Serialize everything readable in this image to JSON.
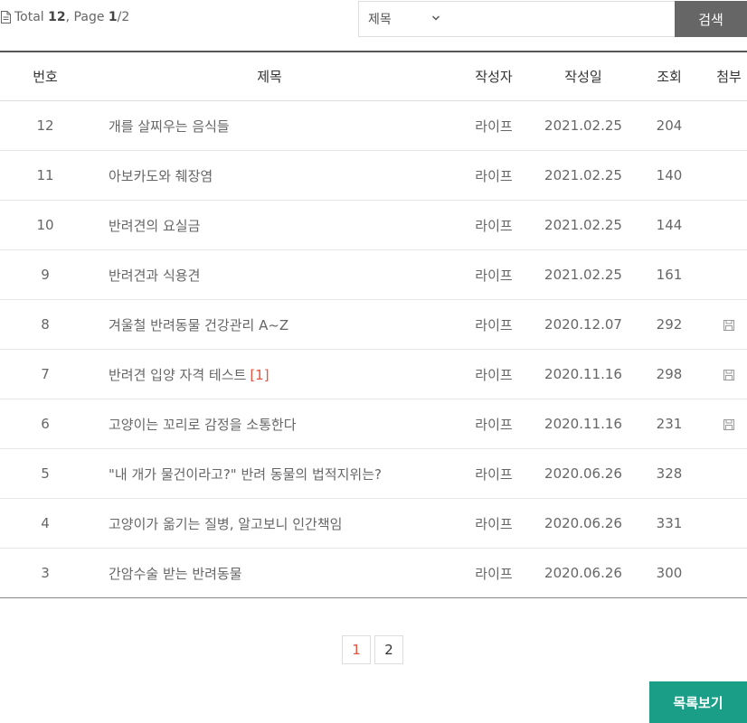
{
  "summary": {
    "total_label": "Total",
    "total": "12",
    "page_label": "Page",
    "page_current": "1",
    "page_total": "2"
  },
  "search": {
    "field_selected": "제목",
    "query": "",
    "button_label": "검색"
  },
  "table": {
    "headers": {
      "num": "번호",
      "title": "제목",
      "author": "작성자",
      "date": "작성일",
      "views": "조회",
      "attach": "첨부"
    },
    "rows": [
      {
        "num": "12",
        "title": "개를 살찌우는 음식들",
        "comments": "",
        "author": "라이프",
        "date": "2021.02.25",
        "views": "204",
        "attachment": false
      },
      {
        "num": "11",
        "title": "아보카도와 췌장염",
        "comments": "",
        "author": "라이프",
        "date": "2021.02.25",
        "views": "140",
        "attachment": false
      },
      {
        "num": "10",
        "title": "반려견의 요실금",
        "comments": "",
        "author": "라이프",
        "date": "2021.02.25",
        "views": "144",
        "attachment": false
      },
      {
        "num": "9",
        "title": "반려견과 식용견",
        "comments": "",
        "author": "라이프",
        "date": "2021.02.25",
        "views": "161",
        "attachment": false
      },
      {
        "num": "8",
        "title": "겨울철 반려동물 건강관리 A~Z",
        "comments": "",
        "author": "라이프",
        "date": "2020.12.07",
        "views": "292",
        "attachment": true
      },
      {
        "num": "7",
        "title": "반려견 입양 자격 테스트",
        "comments": "[1]",
        "author": "라이프",
        "date": "2020.11.16",
        "views": "298",
        "attachment": true
      },
      {
        "num": "6",
        "title": "고양이는 꼬리로 감정을 소통한다",
        "comments": "",
        "author": "라이프",
        "date": "2020.11.16",
        "views": "231",
        "attachment": true
      },
      {
        "num": "5",
        "title": "\"내 개가 물건이라고?\" 반려 동물의 법적지위는?",
        "comments": "",
        "author": "라이프",
        "date": "2020.06.26",
        "views": "328",
        "attachment": false
      },
      {
        "num": "4",
        "title": "고양이가 옮기는 질병, 알고보니 인간책임",
        "comments": "",
        "author": "라이프",
        "date": "2020.06.26",
        "views": "331",
        "attachment": false
      },
      {
        "num": "3",
        "title": "간암수술 받는 반려동물",
        "comments": "",
        "author": "라이프",
        "date": "2020.06.26",
        "views": "300",
        "attachment": false
      }
    ]
  },
  "pagination": {
    "pages": [
      "1",
      "2"
    ],
    "active": "1"
  },
  "actions": {
    "list_button": "목록보기"
  },
  "colors": {
    "accent": "#e8543d",
    "list_button": "#1a9e88",
    "search_button": "#666666"
  },
  "icons": {
    "summary": "document-icon",
    "attachment": "floppy-disk-icon",
    "select": "chevron-down-icon"
  }
}
